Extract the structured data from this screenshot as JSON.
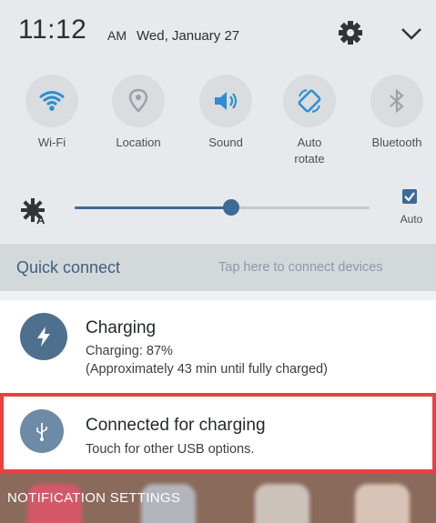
{
  "status": {
    "time": "11:12",
    "ampm": "AM",
    "date": "Wed, January 27",
    "icons": [
      "gear-icon",
      "chevron-down-icon"
    ]
  },
  "toggles": [
    {
      "label": "Wi-Fi",
      "icon": "wifi-icon"
    },
    {
      "label": "Location",
      "icon": "location-icon"
    },
    {
      "label": "Sound",
      "icon": "sound-icon"
    },
    {
      "label": "Auto\nrotate",
      "icon": "auto-rotate-icon"
    },
    {
      "label": "Bluetooth",
      "icon": "bluetooth-icon"
    }
  ],
  "brightness": {
    "level": 0.53,
    "auto_label": "Auto",
    "auto_checked": true
  },
  "quick_connect": {
    "title": "Quick connect",
    "hint": "Tap here to connect devices"
  },
  "notifications": [
    {
      "title": "Charging",
      "line1": "Charging: 87%",
      "line2": "(Approximately 43 min until fully charged)",
      "icon": "bolt-icon"
    },
    {
      "title": "Connected for charging",
      "line1": "Touch for other USB options.",
      "icon": "usb-icon"
    }
  ],
  "footer": {
    "settings_label": "NOTIFICATION SETTINGS"
  },
  "colors": {
    "accent": "#3e6a96",
    "highlight_border": "#e94141",
    "panel_bg": "#e7eaec"
  }
}
